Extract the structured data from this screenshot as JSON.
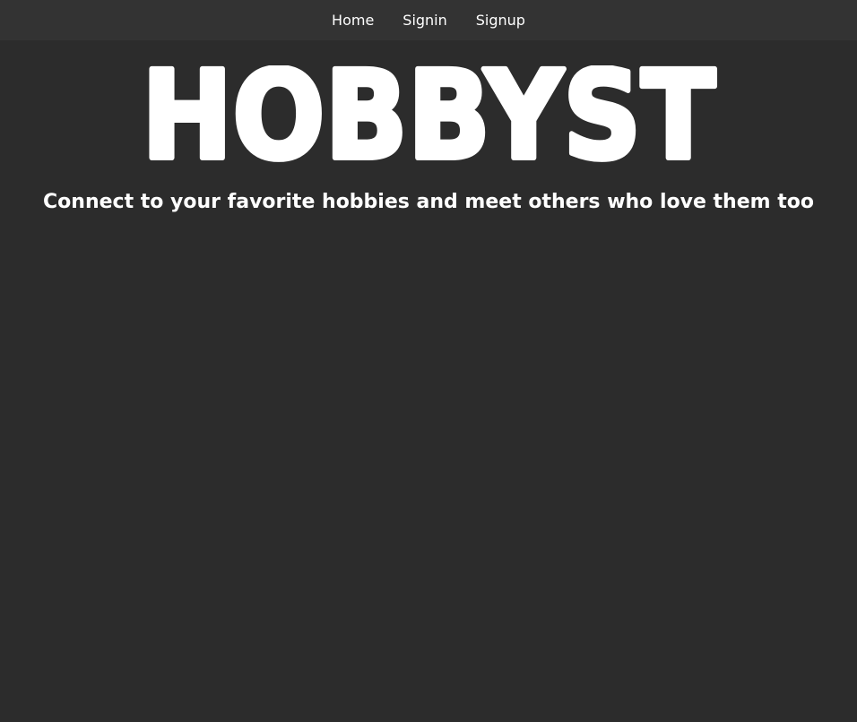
{
  "nav": {
    "items": [
      {
        "label": "Home"
      },
      {
        "label": "Signin"
      },
      {
        "label": "Signup"
      }
    ]
  },
  "hero": {
    "logo_text": "HOBBYST",
    "tagline": "Connect to your favorite hobbies and meet others who love them too"
  },
  "colors": {
    "background": "#2c2c2c",
    "navbar": "#333333",
    "text": "#ffffff"
  }
}
